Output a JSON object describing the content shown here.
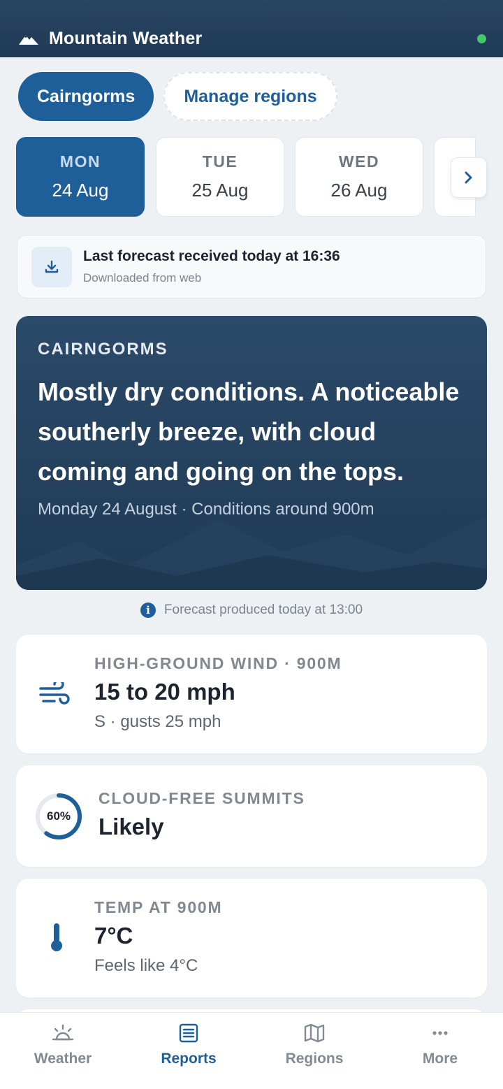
{
  "app": {
    "title": "Mountain Weather"
  },
  "colors": {
    "primary": "#1e5f9a",
    "header": "#1f3a57",
    "online": "#43c86b"
  },
  "regions": {
    "selected": "Cairngorms",
    "manage_label": "Manage regions"
  },
  "days": [
    {
      "dow": "MON",
      "date": "24 Aug",
      "active": true
    },
    {
      "dow": "TUE",
      "date": "25 Aug"
    },
    {
      "dow": "WED",
      "date": "26 Aug"
    }
  ],
  "banner": {
    "title": "Last forecast received today at 16:36",
    "subtitle": "Downloaded from web"
  },
  "hero": {
    "region": "CAIRNGORMS",
    "summary": "Mostly dry conditions. A noticeable southerly breeze, with cloud coming and going on the tops.",
    "sub": "Monday 24 August · Conditions around 900m"
  },
  "produced": "Forecast produced today at 13:00",
  "metrics": {
    "wind": {
      "label": "HIGH-GROUND WIND · 900M",
      "value": "15 to 20 mph",
      "sub": "S · gusts 25 mph",
      "icon": "wind-icon"
    },
    "cloud": {
      "label": "CLOUD-FREE SUMMITS",
      "value": "Likely",
      "percent_label": "60%",
      "percent": 0.6
    },
    "temp": {
      "label": "TEMP AT 900M",
      "value": "7°C",
      "sub": "Feels like 4°C",
      "icon": "thermometer-icon"
    }
  },
  "nav": {
    "active": "Reports",
    "items": [
      {
        "label": "Weather",
        "icon": "sun-cloud-icon"
      },
      {
        "label": "Reports",
        "icon": "report-icon"
      },
      {
        "label": "Regions",
        "icon": "map-icon"
      },
      {
        "label": "More",
        "icon": "more-icon"
      }
    ]
  }
}
